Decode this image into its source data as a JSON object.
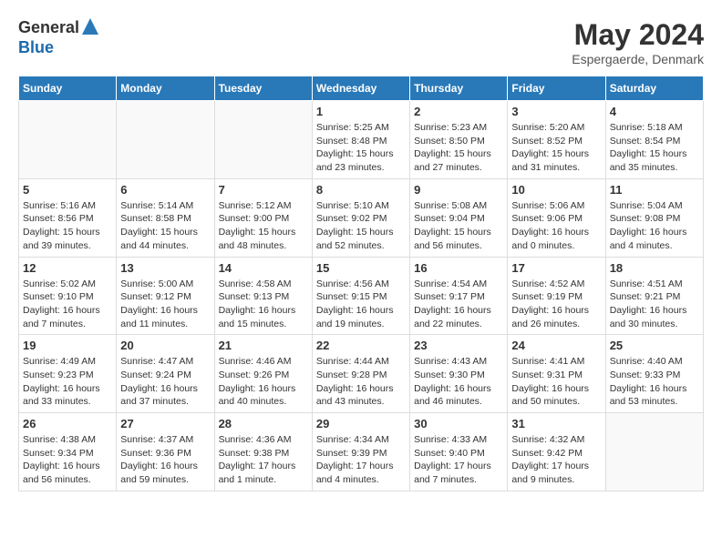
{
  "logo": {
    "general": "General",
    "blue": "Blue"
  },
  "header": {
    "title": "May 2024",
    "location": "Espergaerde, Denmark"
  },
  "weekdays": [
    "Sunday",
    "Monday",
    "Tuesday",
    "Wednesday",
    "Thursday",
    "Friday",
    "Saturday"
  ],
  "weeks": [
    [
      {
        "day": "",
        "info": ""
      },
      {
        "day": "",
        "info": ""
      },
      {
        "day": "",
        "info": ""
      },
      {
        "day": "1",
        "info": "Sunrise: 5:25 AM\nSunset: 8:48 PM\nDaylight: 15 hours\nand 23 minutes."
      },
      {
        "day": "2",
        "info": "Sunrise: 5:23 AM\nSunset: 8:50 PM\nDaylight: 15 hours\nand 27 minutes."
      },
      {
        "day": "3",
        "info": "Sunrise: 5:20 AM\nSunset: 8:52 PM\nDaylight: 15 hours\nand 31 minutes."
      },
      {
        "day": "4",
        "info": "Sunrise: 5:18 AM\nSunset: 8:54 PM\nDaylight: 15 hours\nand 35 minutes."
      }
    ],
    [
      {
        "day": "5",
        "info": "Sunrise: 5:16 AM\nSunset: 8:56 PM\nDaylight: 15 hours\nand 39 minutes."
      },
      {
        "day": "6",
        "info": "Sunrise: 5:14 AM\nSunset: 8:58 PM\nDaylight: 15 hours\nand 44 minutes."
      },
      {
        "day": "7",
        "info": "Sunrise: 5:12 AM\nSunset: 9:00 PM\nDaylight: 15 hours\nand 48 minutes."
      },
      {
        "day": "8",
        "info": "Sunrise: 5:10 AM\nSunset: 9:02 PM\nDaylight: 15 hours\nand 52 minutes."
      },
      {
        "day": "9",
        "info": "Sunrise: 5:08 AM\nSunset: 9:04 PM\nDaylight: 15 hours\nand 56 minutes."
      },
      {
        "day": "10",
        "info": "Sunrise: 5:06 AM\nSunset: 9:06 PM\nDaylight: 16 hours\nand 0 minutes."
      },
      {
        "day": "11",
        "info": "Sunrise: 5:04 AM\nSunset: 9:08 PM\nDaylight: 16 hours\nand 4 minutes."
      }
    ],
    [
      {
        "day": "12",
        "info": "Sunrise: 5:02 AM\nSunset: 9:10 PM\nDaylight: 16 hours\nand 7 minutes."
      },
      {
        "day": "13",
        "info": "Sunrise: 5:00 AM\nSunset: 9:12 PM\nDaylight: 16 hours\nand 11 minutes."
      },
      {
        "day": "14",
        "info": "Sunrise: 4:58 AM\nSunset: 9:13 PM\nDaylight: 16 hours\nand 15 minutes."
      },
      {
        "day": "15",
        "info": "Sunrise: 4:56 AM\nSunset: 9:15 PM\nDaylight: 16 hours\nand 19 minutes."
      },
      {
        "day": "16",
        "info": "Sunrise: 4:54 AM\nSunset: 9:17 PM\nDaylight: 16 hours\nand 22 minutes."
      },
      {
        "day": "17",
        "info": "Sunrise: 4:52 AM\nSunset: 9:19 PM\nDaylight: 16 hours\nand 26 minutes."
      },
      {
        "day": "18",
        "info": "Sunrise: 4:51 AM\nSunset: 9:21 PM\nDaylight: 16 hours\nand 30 minutes."
      }
    ],
    [
      {
        "day": "19",
        "info": "Sunrise: 4:49 AM\nSunset: 9:23 PM\nDaylight: 16 hours\nand 33 minutes."
      },
      {
        "day": "20",
        "info": "Sunrise: 4:47 AM\nSunset: 9:24 PM\nDaylight: 16 hours\nand 37 minutes."
      },
      {
        "day": "21",
        "info": "Sunrise: 4:46 AM\nSunset: 9:26 PM\nDaylight: 16 hours\nand 40 minutes."
      },
      {
        "day": "22",
        "info": "Sunrise: 4:44 AM\nSunset: 9:28 PM\nDaylight: 16 hours\nand 43 minutes."
      },
      {
        "day": "23",
        "info": "Sunrise: 4:43 AM\nSunset: 9:30 PM\nDaylight: 16 hours\nand 46 minutes."
      },
      {
        "day": "24",
        "info": "Sunrise: 4:41 AM\nSunset: 9:31 PM\nDaylight: 16 hours\nand 50 minutes."
      },
      {
        "day": "25",
        "info": "Sunrise: 4:40 AM\nSunset: 9:33 PM\nDaylight: 16 hours\nand 53 minutes."
      }
    ],
    [
      {
        "day": "26",
        "info": "Sunrise: 4:38 AM\nSunset: 9:34 PM\nDaylight: 16 hours\nand 56 minutes."
      },
      {
        "day": "27",
        "info": "Sunrise: 4:37 AM\nSunset: 9:36 PM\nDaylight: 16 hours\nand 59 minutes."
      },
      {
        "day": "28",
        "info": "Sunrise: 4:36 AM\nSunset: 9:38 PM\nDaylight: 17 hours\nand 1 minute."
      },
      {
        "day": "29",
        "info": "Sunrise: 4:34 AM\nSunset: 9:39 PM\nDaylight: 17 hours\nand 4 minutes."
      },
      {
        "day": "30",
        "info": "Sunrise: 4:33 AM\nSunset: 9:40 PM\nDaylight: 17 hours\nand 7 minutes."
      },
      {
        "day": "31",
        "info": "Sunrise: 4:32 AM\nSunset: 9:42 PM\nDaylight: 17 hours\nand 9 minutes."
      },
      {
        "day": "",
        "info": ""
      }
    ]
  ]
}
